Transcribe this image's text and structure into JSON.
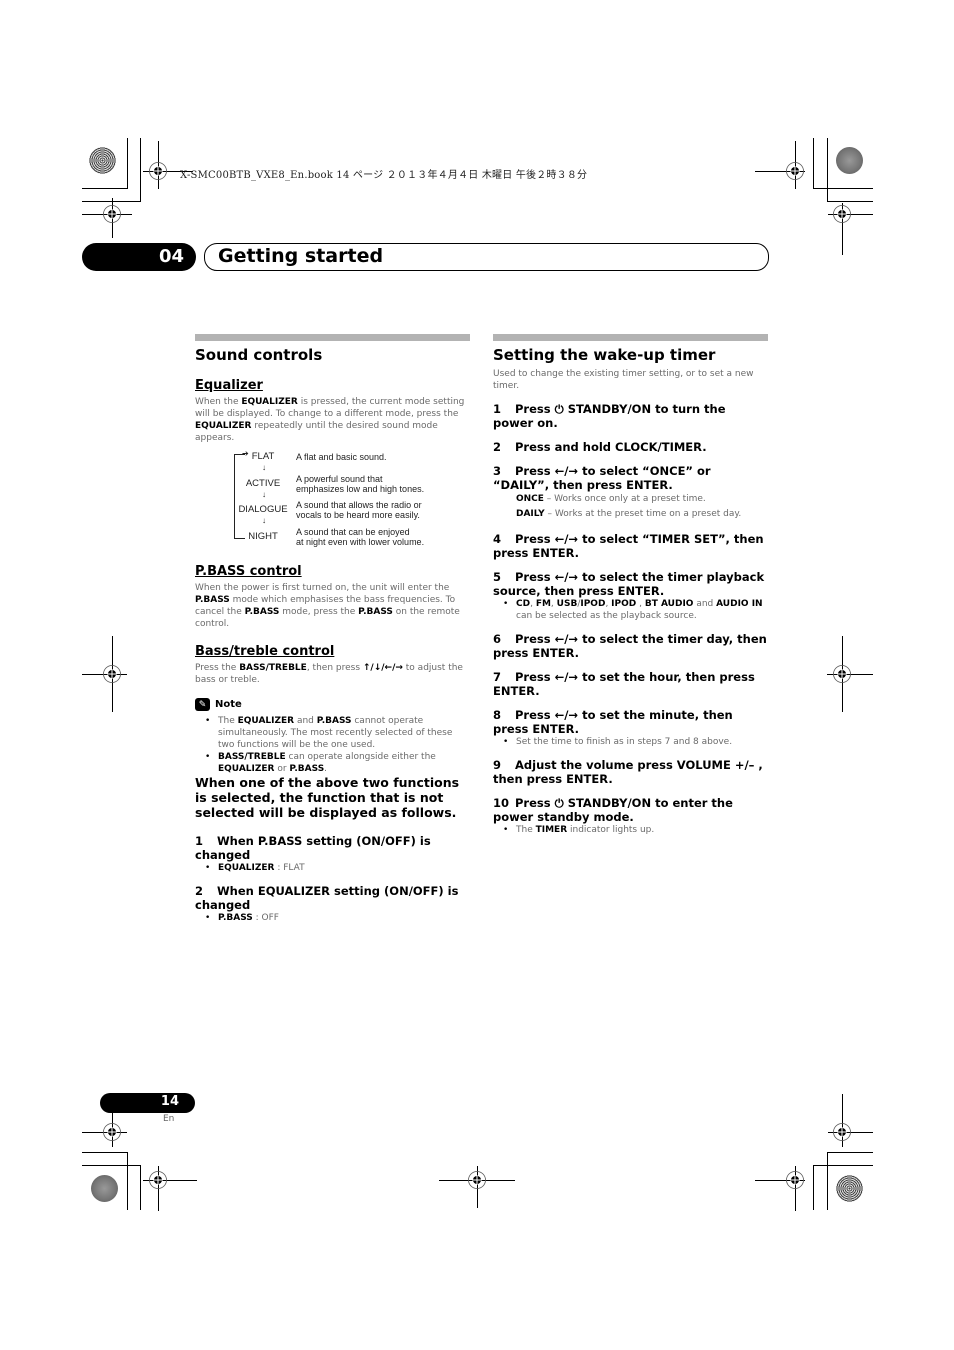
{
  "print_header": "X-SMC00BTB_VXE8_En.book  14 ページ  ２０１３年４月４日  木曜日  午後２時３８分",
  "chapter": {
    "number": "04",
    "title": "Getting started"
  },
  "left": {
    "section_title": "Sound controls",
    "equalizer": {
      "heading": "Equalizer",
      "para_parts": [
        "When the ",
        "EQUALIZER",
        " is pressed, the current mode setting will be displayed. To change to a different mode, press the ",
        "EQUALIZER",
        " repeatedly until the desired sound mode appears."
      ],
      "modes": [
        {
          "name": "FLAT",
          "desc": "A flat and basic sound."
        },
        {
          "name": "ACTIVE",
          "desc": "A powerful sound that emphasizes low and high tones."
        },
        {
          "name": "DIALOGUE",
          "desc": "A sound that allows the radio or vocals to be heard more easily."
        },
        {
          "name": "NIGHT",
          "desc": "A sound that can be enjoyed at night even with lower volume."
        }
      ],
      "modes_desc_lines": [
        [
          "A flat and basic sound."
        ],
        [
          "A powerful sound that",
          "emphasizes low and high tones."
        ],
        [
          "A sound that allows the radio or",
          "vocals to be heard more easily."
        ],
        [
          "A sound that can be enjoyed",
          "at night even with lower volume."
        ]
      ]
    },
    "pbass": {
      "heading": "P.BASS control",
      "para_parts": [
        "When the power is first turned on, the unit will enter the ",
        "P.BASS",
        " mode which emphasises the bass frequencies. To cancel the ",
        "P.BASS",
        " mode, press the ",
        "P.BASS",
        " on the remote control."
      ]
    },
    "bass_treble": {
      "heading": "Bass/treble control",
      "para_parts": [
        "Press the ",
        "BASS/TREBLE",
        ", then press ",
        "↑/↓/←/→",
        " to adjust the bass or treble."
      ]
    },
    "note": {
      "label": "Note",
      "icon": "pencil-icon",
      "items": [
        [
          "The ",
          "EQUALIZER",
          " and ",
          "P.BASS",
          " cannot operate simultaneously. The most recently selected of these two functions will be the one used."
        ],
        [
          "",
          "BASS/TREBLE",
          " can operate alongside either the ",
          "EQUALIZER",
          " or ",
          "P.BASS",
          "."
        ]
      ]
    },
    "bold_para": "When one of the above two functions is selected, the function that is not selected will be displayed as follows.",
    "steps": [
      {
        "num": "1",
        "text": "When P.BASS setting (ON/OFF) is changed",
        "bullet_key": "EQUALIZER",
        "bullet_val": " : FLAT"
      },
      {
        "num": "2",
        "text": "When EQUALIZER setting (ON/OFF) is changed",
        "bullet_key": "P.BASS",
        "bullet_val": " : OFF"
      }
    ]
  },
  "right": {
    "section_title": "Setting the wake-up timer",
    "intro": "Used to change the existing timer setting, or to set a new timer.",
    "steps": [
      {
        "num": "1",
        "text": "Press ⏻ STANDBY/ON to turn the power on."
      },
      {
        "num": "2",
        "text": "Press and hold CLOCK/TIMER."
      },
      {
        "num": "3",
        "text": "Press ←/→ to select “ONCE” or “DAILY”, then press ENTER."
      },
      {
        "num": "4",
        "text": "Press ←/→ to select “TIMER SET”, then press ENTER."
      },
      {
        "num": "5",
        "text": "Press ←/→ to select the timer playback source, then press ENTER."
      },
      {
        "num": "6",
        "text": "Press ←/→ to select the timer day, then press ENTER."
      },
      {
        "num": "7",
        "text": "Press ←/→ to set the hour, then press ENTER."
      },
      {
        "num": "8",
        "text": "Press ←/→ to set the minute, then press ENTER."
      },
      {
        "num": "9",
        "text": "Adjust the volume press VOLUME +/– , then press ENTER."
      },
      {
        "num": "10",
        "text": "Press ⏻ STANDBY/ON to enter the power standby mode."
      }
    ],
    "step3_subs": [
      {
        "key": "ONCE",
        "text": " – Works once only at a preset time."
      },
      {
        "key": "DAILY",
        "text": " – Works at the preset time on a preset day."
      }
    ],
    "step5_bullet": {
      "parts": [
        "CD",
        ", ",
        "FM",
        ", ",
        "USB",
        "/",
        "IPOD",
        ", ",
        "IPOD",
        " , ",
        "BT AUDIO",
        " and ",
        "AUDIO IN",
        " can be selected as the playback source."
      ]
    },
    "step8_bullet": "Set the time to finish as in steps 7 and 8 above.",
    "step10_bullet": {
      "parts": [
        "The ",
        "TIMER",
        " indicator lights up."
      ]
    }
  },
  "footer": {
    "page_number": "14",
    "language": "En"
  }
}
